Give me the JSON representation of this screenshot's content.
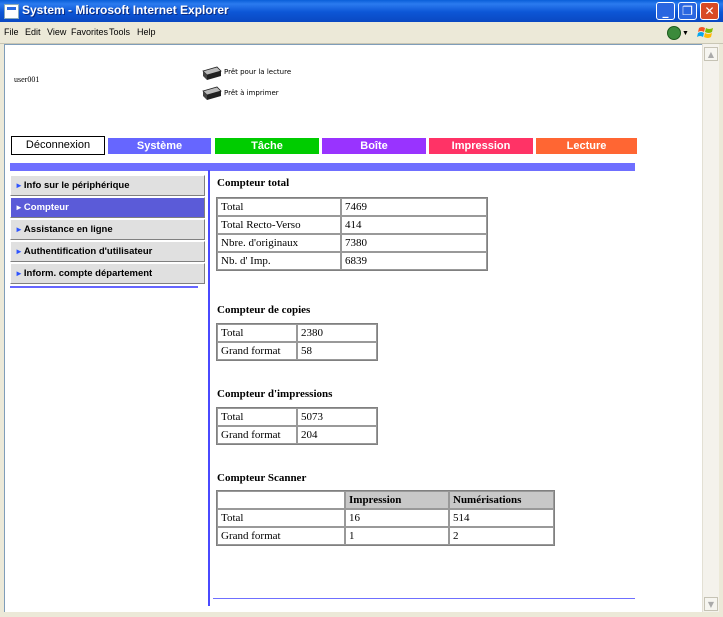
{
  "window": {
    "title": "System - Microsoft Internet Explorer",
    "menus": [
      "File",
      "Edit",
      "View",
      "Favorites",
      "Tools",
      "Help"
    ]
  },
  "status": {
    "ready_read": "Prêt pour la lecture",
    "ready_print": "Prêt à imprimer"
  },
  "user": "user001",
  "logout_label": "Déconnexion",
  "tabs": [
    {
      "label": "Système",
      "color": "#6666FF"
    },
    {
      "label": "Tâche",
      "color": "#00CC00"
    },
    {
      "label": "Boîte",
      "color": "#9933FF"
    },
    {
      "label": "Impression",
      "color": "#FF3366"
    },
    {
      "label": "Lecture",
      "color": "#FF6633"
    }
  ],
  "sidebar": {
    "items": [
      {
        "label": "Info sur le périphérique",
        "active": false
      },
      {
        "label": "Compteur",
        "active": true
      },
      {
        "label": "Assistance en ligne",
        "active": false
      },
      {
        "label": "Authentification d'utilisateur",
        "active": false
      },
      {
        "label": "Inform. compte département",
        "active": false
      }
    ]
  },
  "sections": {
    "total": {
      "title": "Compteur total",
      "rows": [
        {
          "label": "Total",
          "value": "7469"
        },
        {
          "label": "Total Recto-Verso",
          "value": "414"
        },
        {
          "label": "Nbre. d'originaux",
          "value": "7380"
        },
        {
          "label": "Nb. d' Imp.",
          "value": "6839"
        }
      ]
    },
    "copies": {
      "title": "Compteur de copies",
      "rows": [
        {
          "label": "Total",
          "value": "2380"
        },
        {
          "label": "Grand format",
          "value": "58"
        }
      ]
    },
    "prints": {
      "title": "Compteur d'impressions",
      "rows": [
        {
          "label": "Total",
          "value": "5073"
        },
        {
          "label": "Grand format",
          "value": "204"
        }
      ]
    },
    "scanner": {
      "title": "Compteur Scanner",
      "headers": [
        "",
        "Impression",
        "Numérisations"
      ],
      "rows": [
        {
          "label": "Total",
          "impression": "16",
          "scans": "514"
        },
        {
          "label": "Grand format",
          "impression": "1",
          "scans": "2"
        }
      ]
    }
  }
}
